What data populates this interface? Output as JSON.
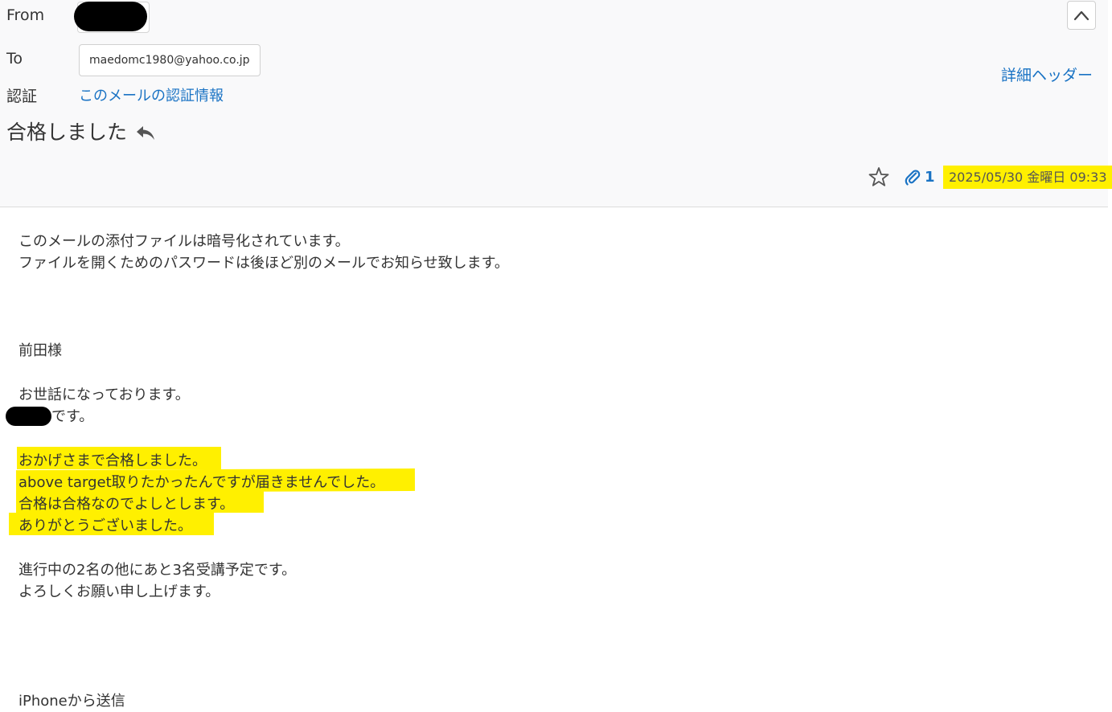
{
  "header": {
    "from_label": "From",
    "to_label": "To",
    "to_value": "maedomc1980@yahoo.co.jp",
    "auth_label": "認証",
    "auth_link": "このメールの認証情報",
    "detail_header_link": "詳細ヘッダー",
    "subject": "合格しました",
    "attachment_count": "1",
    "date": "2025/05/30 金曜日 09:33"
  },
  "body": {
    "notice_line1": "このメールの添付ファイルは暗号化されています。",
    "notice_line2": "ファイルを開くためのパスワードは後ほど別のメールでお知らせ致します。",
    "greeting_name": "前田様",
    "greeting": "お世話になっております。",
    "sender_suffix": "です。",
    "highlight_line1": "おかげさまで合格しました。",
    "highlight_line2": "above target取りたかったんですが届きませんでした。",
    "highlight_line3": "合格は合格なのでよしとします。",
    "highlight_line4": "ありがとうございました。",
    "plan_line1": "進行中の2名の他にあと3名受講予定です。",
    "plan_line2": "よろしくお願い申し上げます。",
    "signature": "iPhoneから送信"
  },
  "colors": {
    "highlight": "#fff000",
    "link": "#1a73c4"
  },
  "icons": {
    "collapse": "chevron-up-icon",
    "reply": "reply-icon",
    "star": "star-icon",
    "attachment": "paperclip-icon"
  }
}
